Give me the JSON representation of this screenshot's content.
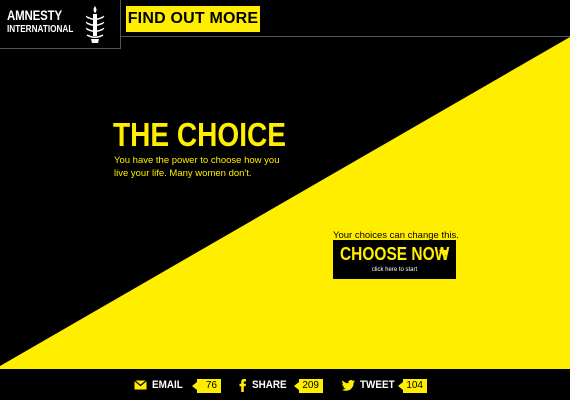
{
  "brand": {
    "line1": "AMNESTY",
    "line2": "INTERNATIONAL",
    "logo_icon": "candle-in-barbed-wire-icon"
  },
  "header": {
    "find_out_label": "FIND OUT MORE >"
  },
  "hero": {
    "title": "THE CHOICE",
    "subtitle": "You have the power to choose how you live your life. Many women don't."
  },
  "cta": {
    "caption": "Your choices can change this.",
    "label": "CHOOSE NOW",
    "sublabel": "click here to start",
    "arrow_icon": "triangle-down-icon"
  },
  "share": {
    "email": {
      "label": "EMAIL",
      "count": "76",
      "icon": "envelope-icon"
    },
    "facebook": {
      "label": "SHARE",
      "count": "209",
      "icon": "facebook-icon"
    },
    "twitter": {
      "label": "TWEET",
      "count": "104",
      "icon": "twitter-bird-icon"
    }
  },
  "colors": {
    "accent": "#ffee00",
    "background": "#000000",
    "text_light": "#ffffff"
  }
}
